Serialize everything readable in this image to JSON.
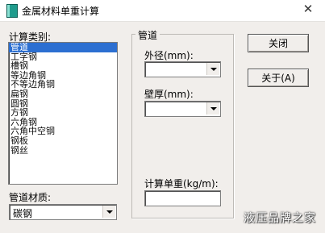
{
  "window": {
    "title": "金属材料单重计算",
    "close_glyph": "✕"
  },
  "calc_type": {
    "label": "计算类别:",
    "items": [
      "管道",
      "工字钢",
      "槽钢",
      "等边角钢",
      "不等边角钢",
      "扁钢",
      "圆钢",
      "方钢",
      "六角钢",
      "六角中空钢",
      "钢板",
      "钢丝"
    ],
    "selected": "管道"
  },
  "material": {
    "label": "管道材质:",
    "value": "碳钢"
  },
  "pipe_group": {
    "caption": "管道",
    "outer_diameter_label": "外径(mm):",
    "outer_diameter_value": "",
    "wall_thickness_label": "壁厚(mm):",
    "wall_thickness_value": "",
    "unit_weight_label": "计算单重(kg/m):",
    "unit_weight_value": ""
  },
  "buttons": {
    "close": "关闭",
    "about": "关于(A)"
  },
  "watermark": "液压品牌之家",
  "colors": {
    "selection": "#2c6fd1",
    "face": "#f1eeeb"
  }
}
